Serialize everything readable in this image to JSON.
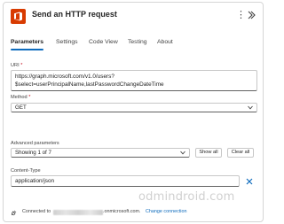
{
  "header": {
    "title": "Send an HTTP request",
    "more_glyph": "⋮"
  },
  "tabs": [
    {
      "label": "Parameters",
      "active": true
    },
    {
      "label": "Settings",
      "active": false
    },
    {
      "label": "Code View",
      "active": false
    },
    {
      "label": "Testing",
      "active": false
    },
    {
      "label": "About",
      "active": false
    }
  ],
  "uri": {
    "label": "URI",
    "required_mark": "*",
    "line1": "https://graph.microsoft.com/v1.0/users?",
    "line2": "$select=userPrincipalName,lastPasswordChangeDateTime"
  },
  "method": {
    "label": "Method",
    "required_mark": "*",
    "value": "GET"
  },
  "advanced": {
    "label": "Advanced parameters",
    "value": "Showing 1 of 7",
    "show_all": "Show all",
    "clear_all": "Clear all"
  },
  "content_type": {
    "label": "Content-Type",
    "value": "application/json"
  },
  "footer": {
    "connected_prefix": "Connected to",
    "domain_suffix": ".onmicrosoft.com.",
    "change_connection": "Change connection"
  },
  "watermark": "odmindroid.com",
  "colors": {
    "accent": "#0f6cbd",
    "brand": "#d83b01",
    "required": "#c50f1f"
  },
  "icons": [
    "office-app-icon",
    "more-vertical-icon",
    "collapse-chevron-icon",
    "chevron-down-icon",
    "close-icon",
    "plug-icon"
  ]
}
